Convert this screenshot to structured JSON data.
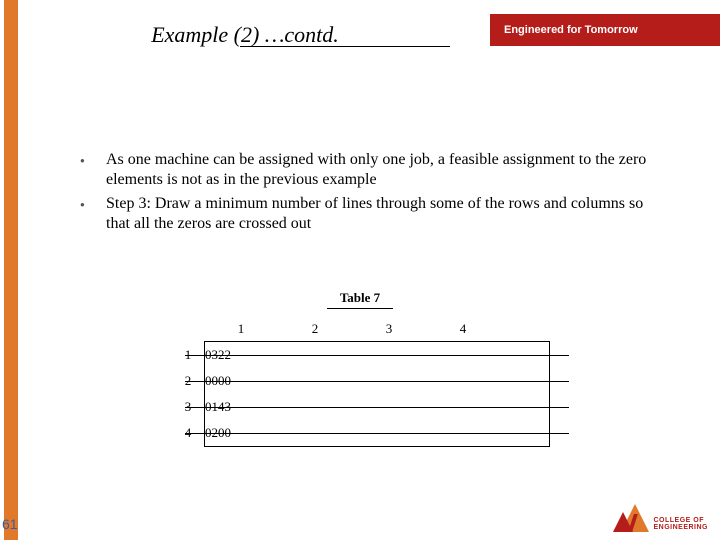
{
  "header": {
    "title": "Example (2) …contd.",
    "tagline": "Engineered for Tomorrow"
  },
  "bullets": [
    "As one machine can be assigned with only one job, a feasible assignment to the zero elements is not as in the previous example",
    "Step 3: Draw a minimum number of lines through some of the rows and columns so that all the zeros are crossed out"
  ],
  "chart_data": {
    "type": "table",
    "caption": "Table 7",
    "col_headers": [
      "1",
      "2",
      "3",
      "4"
    ],
    "row_headers": [
      "1",
      "2",
      "3",
      "4"
    ],
    "rows": [
      [
        "0",
        "3",
        "2",
        "2"
      ],
      [
        "0",
        "0",
        "0",
        "0"
      ],
      [
        "0",
        "1",
        "4",
        "3"
      ],
      [
        "0",
        "2",
        "0",
        "0"
      ]
    ],
    "lines": {
      "row_lines": [
        0,
        1,
        2,
        3
      ],
      "col_lines": []
    }
  },
  "footer": {
    "slide_number": "61",
    "logo": {
      "line1": "COLLEGE OF",
      "line2": "ENGINEERING"
    }
  }
}
